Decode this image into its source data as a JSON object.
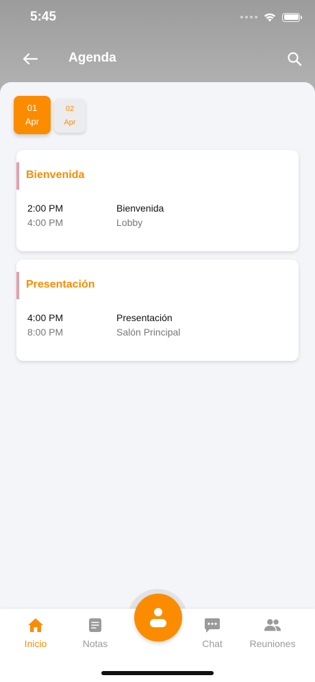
{
  "status_bar": {
    "time": "5:45"
  },
  "header": {
    "title": "Agenda"
  },
  "dates": [
    {
      "day": "01",
      "month": "Apr",
      "selected": true
    },
    {
      "day": "02",
      "month": "Apr",
      "selected": false
    }
  ],
  "events": [
    {
      "title": "Bienvenida",
      "start": "2:00 PM",
      "end": "4:00 PM",
      "name": "Bienvenida",
      "location": "Lobby"
    },
    {
      "title": "Presentación",
      "start": "4:00 PM",
      "end": "8:00 PM",
      "name": "Presentación",
      "location": "Salón Principal"
    }
  ],
  "tabs": [
    {
      "label": "Inicio",
      "icon": "home-icon",
      "active": true
    },
    {
      "label": "Notas",
      "icon": "notes-icon",
      "active": false
    },
    {
      "label": "Chat",
      "icon": "chat-icon",
      "active": false
    },
    {
      "label": "Reuniones",
      "icon": "people-icon",
      "active": false
    }
  ],
  "fab": {
    "icon": "person-icon"
  },
  "colors": {
    "accent": "#fb8c00",
    "card_accent": "#e3a0ad",
    "background": "#f4f5f9"
  }
}
